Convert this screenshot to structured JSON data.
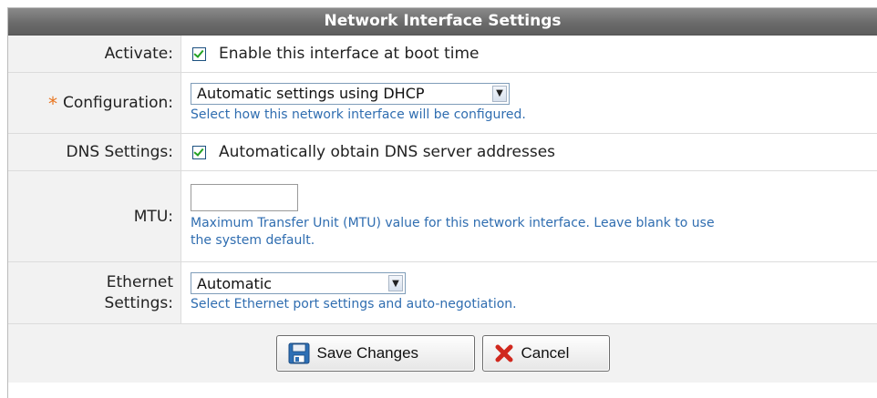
{
  "header": {
    "title": "Network Interface Settings"
  },
  "activate": {
    "label": "Activate:",
    "checked": true,
    "checkbox_label": "Enable this interface at boot time"
  },
  "configuration": {
    "required_mark": "*",
    "label": "Configuration:",
    "selected": "Automatic settings using DHCP",
    "hint": "Select how this network interface will be configured."
  },
  "dns": {
    "label": "DNS Settings:",
    "checked": true,
    "checkbox_label": "Automatically obtain DNS server addresses"
  },
  "mtu": {
    "label": "MTU:",
    "value": "",
    "hint_line1": "Maximum Transfer Unit (MTU) value for this network interface. Leave blank to use",
    "hint_line2": "the system default."
  },
  "ethernet": {
    "label_line1": "Ethernet",
    "label_line2": "Settings:",
    "selected": "Automatic",
    "hint": "Select Ethernet port settings and auto-negotiation."
  },
  "buttons": {
    "save": "Save Changes",
    "cancel": "Cancel"
  },
  "icons": {
    "save": "floppy-disk-icon",
    "cancel": "red-x-icon",
    "dropdown": "chevron-down-icon"
  },
  "colors": {
    "header_bg": "#6b6b6b",
    "hint_text": "#2f6db0",
    "required": "#e8741e",
    "check": "#21a121",
    "cancel_x": "#d0281e"
  }
}
